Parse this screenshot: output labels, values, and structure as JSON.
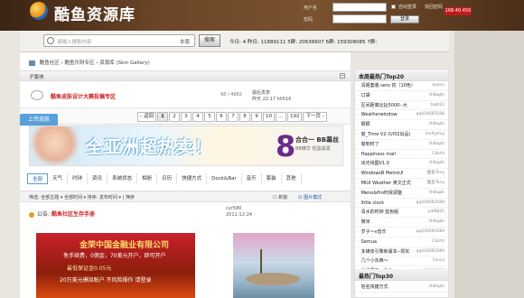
{
  "header": {
    "site_title": "酷鱼资源库",
    "label_user": "用户名",
    "label_pass": "密码",
    "auto_login": "自动登录",
    "find_pass": "找回密码",
    "login_btn": "登录",
    "badge": "168.40.450"
  },
  "search": {
    "placeholder": "请输入搜索内容",
    "scope": "本版",
    "button": "搜索",
    "stats": "今日: 4   昨日: 11889111   5群: 20636607   6群: 159308085   7群:"
  },
  "breadcrumb": [
    "酷鱼社区",
    "酷鱼乐财专区",
    "资源库 (Skin Gallery)"
  ],
  "subboards": {
    "header": "子版块",
    "item_title": "酷鱼皮肤设计大赛投稿专区",
    "item_count": "68 / 4882",
    "item_last_label": "最后发表",
    "item_last_time": "昨天 22:17 hh516"
  },
  "topic_tag": "上传皮肤",
  "pager": {
    "prev": "‹ 返回",
    "pages": [
      "1",
      "2",
      "3",
      "4",
      "5",
      "6",
      "7",
      "8",
      "9",
      "10",
      "...",
      "192"
    ],
    "current": "1",
    "next": "下一页 ›"
  },
  "banner": {
    "big_text": "全亚洲超热卖！",
    "eight": "8",
    "promo": "合合一 BB幕丝",
    "promo_sub": "BB精华 轻盈滋润"
  },
  "category_tabs": [
    "全部",
    "天气",
    "时钟",
    "资讯",
    "系统状态",
    "相册",
    "日历",
    "快捷方式",
    "Dock&Bar",
    "音乐",
    "套装",
    "其他"
  ],
  "filters": {
    "text": "筛选: 全部主题 ▾   全部时间 ▾   排序: 发布时间 ▾   |   筛序",
    "new_window": "新窗",
    "mode": "图片模式"
  },
  "notice": {
    "prefix": "公告:",
    "title": "酷鱼社区生存手册",
    "author": "cyr580",
    "date": "2011-12-24"
  },
  "thumbs": {
    "t1_line1": "金荣中国金融业有限公司",
    "t1_line2": "免手续费，0佣金，70美元开户，即可开户",
    "t1_line3": "最低保证金0.05元",
    "t1_line4": "20万美元模拟账户 不风险操作 请登录"
  },
  "hot_week": {
    "title": "本周最热门Top20",
    "items": [
      {
        "t": "清姬套装 sero 初（10色）",
        "u": "kyono"
      },
      {
        "t": "口袋",
        "u": "thlbqzh"
      },
      {
        "t": "区间距离比扯5000--大",
        "u": "tsqh22"
      },
      {
        "t": "Weatherwindow",
        "u": "qq416693588"
      },
      {
        "t": "颖颖",
        "u": "thlbqzh"
      },
      {
        "t": "窗_Time V2 (UI5Σ出品)",
        "u": "kinfsjchyj"
      },
      {
        "t": "窗到时了",
        "u": "thlbqzh"
      },
      {
        "t": "Happiness mail",
        "u": "Cdirtd"
      },
      {
        "t": "出光线图V1.0",
        "u": "thlbqzh"
      },
      {
        "t": "WindowsB MetroUI",
        "u": "酷鱼Tony"
      },
      {
        "t": "MIUI Weather 英文正式",
        "u": "酷鱼Tony"
      },
      {
        "t": "Meno&Pro时候调整",
        "u": "thlbqzh"
      },
      {
        "t": "little clock",
        "u": "qq416693589"
      },
      {
        "t": "清水的时钟 蓝色版",
        "u": "yaf8825"
      },
      {
        "t": "微米",
        "u": "thlbqzh"
      },
      {
        "t": "岁子～v音乐",
        "u": "qq416693589"
      },
      {
        "t": "Semua",
        "u": "Cdirtd"
      },
      {
        "t": "多媒体引擎新版本--现实",
        "u": "qq416693589"
      },
      {
        "t": "几个小东西～",
        "u": "Fancy"
      },
      {
        "t": "让世界飞一会儿",
        "u": "gonngying"
      }
    ]
  },
  "hot_month": {
    "title": "最热门Top30",
    "first": {
      "t": "姓名快捷方式",
      "u": "thlbqzh"
    }
  }
}
